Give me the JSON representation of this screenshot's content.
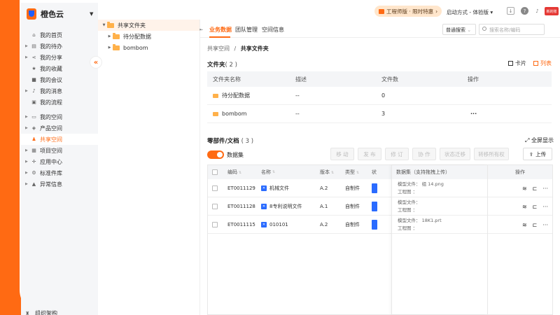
{
  "colors": {
    "accent": "#ff6a13",
    "blue": "#2a6bff"
  },
  "brand": {
    "name": "橙色云"
  },
  "sidebar": {
    "items": [
      {
        "label": "我的首页",
        "icon": "home-icon"
      },
      {
        "label": "我的待办",
        "icon": "todo-icon"
      },
      {
        "label": "我的分享",
        "icon": "share-icon"
      },
      {
        "label": "我的收藏",
        "icon": "star-icon"
      },
      {
        "label": "我的会议",
        "icon": "video-icon"
      },
      {
        "label": "我的消息",
        "icon": "bell-icon"
      },
      {
        "label": "我的流程",
        "icon": "flow-icon"
      },
      {
        "label": "我的空间",
        "icon": "space-icon"
      },
      {
        "label": "产品空间",
        "icon": "cube-icon"
      },
      {
        "label": "共享空间",
        "icon": "people-icon"
      },
      {
        "label": "项目空间",
        "icon": "project-icon"
      },
      {
        "label": "应用中心",
        "icon": "apps-icon"
      },
      {
        "label": "标准件库",
        "icon": "gear-icon"
      },
      {
        "label": "异常信息",
        "icon": "warning-icon"
      }
    ],
    "bottom": "组织架构"
  },
  "tree": {
    "root": "共享文件夹",
    "children": [
      "待分配数据",
      "bombom"
    ]
  },
  "topbar": {
    "promo": "工程师版 · 限时特惠",
    "login_mode": "启动方式 - 体验版",
    "avatar_text": "新的账"
  },
  "tabs": [
    "业务数据",
    "团队管理",
    "空间信息"
  ],
  "search": {
    "mode": "普通搜索",
    "placeholder": "搜索名称/编码"
  },
  "breadcrumb": {
    "parent": "共享空间",
    "sep": "/",
    "current": "共享文件夹"
  },
  "folders": {
    "title": "文件夹",
    "count": "( 2 )",
    "view_card": "卡片",
    "view_list": "列表",
    "headers": [
      "文件夹名称",
      "描述",
      "文件数",
      "操作"
    ],
    "rows": [
      {
        "name": "待分配数据",
        "desc": "--",
        "count": "0",
        "op": ""
      },
      {
        "name": "bombom",
        "desc": "--",
        "count": "3",
        "op": "···"
      }
    ]
  },
  "parts": {
    "title": "零部件/文档",
    "count": "( 3 )",
    "fullscreen": "全屏显示",
    "dataset_label": "数据集",
    "actions": [
      "移 动",
      "发 布",
      "修 订",
      "协 作",
      "状态迁移",
      "转移所有权",
      "删 除"
    ],
    "upload": "上传",
    "headers": [
      "编码",
      "名称",
      "版本",
      "类型",
      "状"
    ],
    "rows": [
      {
        "code": "ET0011129",
        "name": "机械文件",
        "version": "A.2",
        "type": "自制件"
      },
      {
        "code": "ET0011128",
        "name": "8专利说明文件",
        "version": "A.1",
        "type": "自制件"
      },
      {
        "code": "ET0011115",
        "name": "010101",
        "version": "A.2",
        "type": "自制件"
      }
    ],
    "dataset_header": "数据集（支持拖拽上传）",
    "dataset_rows": [
      {
        "model": "模型文件：  组 14.png",
        "drawing": "工程图  ："
      },
      {
        "model": "模型文件：",
        "drawing": "工程图  ："
      },
      {
        "model": "模型文件：  18K1.prt",
        "drawing": "工程图  ："
      }
    ],
    "ops_header": "操作"
  }
}
